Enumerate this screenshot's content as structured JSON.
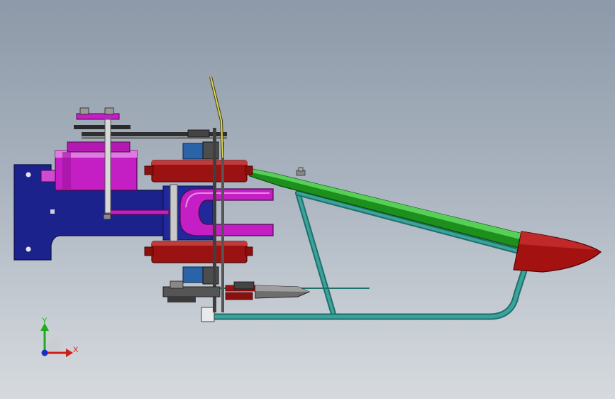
{
  "view": {
    "background_top": "#8d99a8",
    "background_bottom": "#d6dade"
  },
  "model": {
    "parts": [
      {
        "name": "mounting-bracket",
        "color": "#1a1f8c"
      },
      {
        "name": "gearbox-housing",
        "color": "#c41fc4"
      },
      {
        "name": "clevis-fork",
        "color": "#c41fc4"
      },
      {
        "name": "disc-roller",
        "color": "#9a1212"
      },
      {
        "name": "bearing-block",
        "color": "#2b63a8"
      },
      {
        "name": "frame-tube",
        "color": "#2a8c85"
      },
      {
        "name": "boom-arm",
        "color": "#1e9a1e"
      },
      {
        "name": "tip-cap",
        "color": "#a11010"
      },
      {
        "name": "blade",
        "color": "#6e6e6e"
      }
    ]
  },
  "triad": {
    "y_label": "Y",
    "x_label": "X",
    "y_color": "#1faa1f",
    "x_color": "#d11c1c",
    "origin_color": "#1a2fbf"
  }
}
